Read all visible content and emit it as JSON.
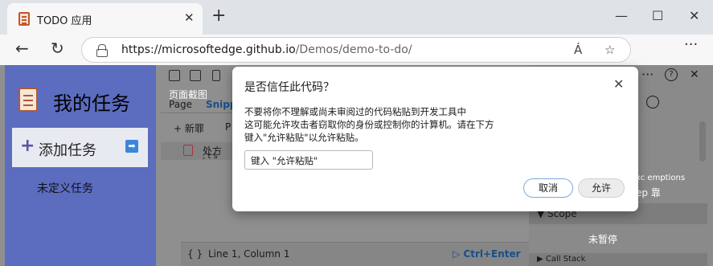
{
  "browser": {
    "tab_title": "TODO 应用",
    "tab_close": "✕",
    "new_tab": "+",
    "minimize": "—",
    "maximize": "☐",
    "close": "✕",
    "back": "←",
    "refresh": "↻",
    "url_host": "https://microsoftedge.github.io",
    "url_path": "/Demos/demo-to-do/",
    "read_aloud": "Á",
    "favorite": "☆",
    "more": "···"
  },
  "todo_app": {
    "title": "我的任务",
    "add_plus": "+",
    "add_label": "添加任务",
    "add_arrow": "➡",
    "undefined_tasks": "未定义任务"
  },
  "devtools": {
    "screenshot_label": "页面截图",
    "tab_page": "Page",
    "tab_snippets": "Snipp",
    "new_label": "+ 新罪",
    "pr_label": "P",
    "snippet_item": "处方",
    "snippet_sub": ", t s",
    "exceptions_label": "xc emptions",
    "exceptions_sub": "ep 靠",
    "scope_label": "▼ Scope",
    "not_paused": "未暂停",
    "callstack_label": "▶ Call Stack",
    "braces": "{ }",
    "position": "Line 1, Column 1",
    "run_label": "▷ Ctrl+Enter",
    "dots": "···",
    "help": "?",
    "close": "✕"
  },
  "dialog": {
    "title": "是否信任此代码？",
    "close": "✕",
    "body_line1": "不要将你不理解或尚未审阅过的代码粘贴到开发工具中",
    "body_line2": "这可能允许攻击者窃取你的身份或控制你的计算机。请在下方",
    "body_line3": "键入\"允许粘贴\"以允许粘贴。",
    "input_value": "键入 \"允许粘贴\"",
    "cancel_label": "取消",
    "allow_label": "允许"
  }
}
